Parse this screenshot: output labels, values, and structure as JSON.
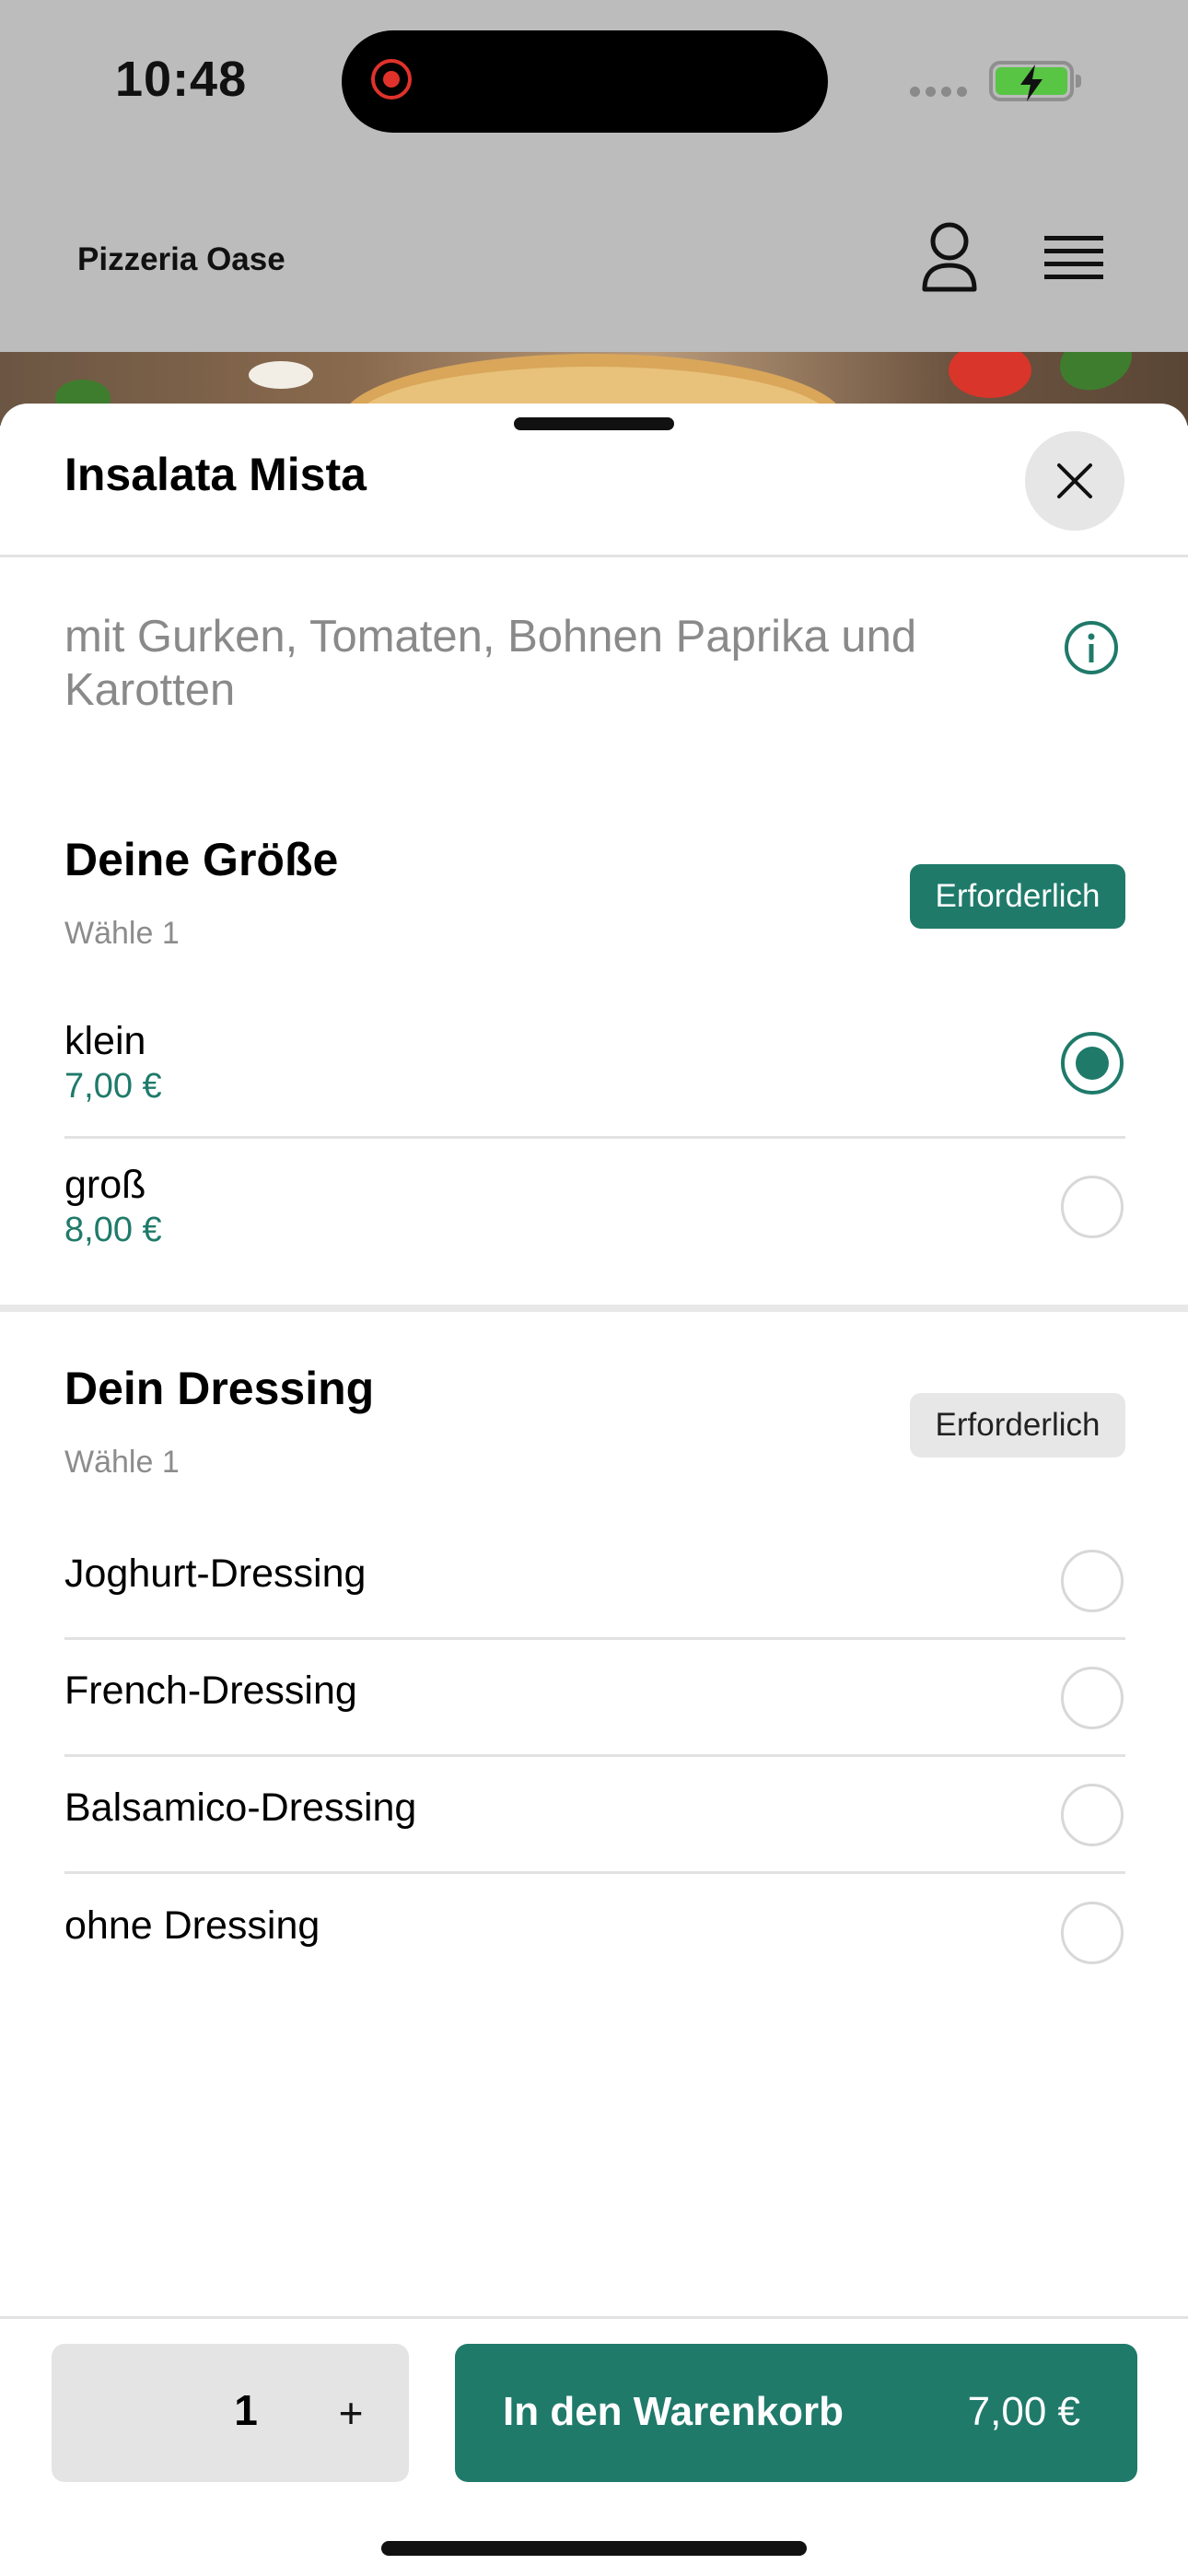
{
  "status_bar": {
    "time": "10:48"
  },
  "app": {
    "title": "Pizzeria Oase"
  },
  "sheet": {
    "title": "Insalata Mista",
    "description": "mit Gurken, Tomaten, Bohnen Paprika und Karotten"
  },
  "size_section": {
    "title": "Deine Größe",
    "subtitle": "Wähle 1",
    "badge": "Erforderlich",
    "options": [
      {
        "label": "klein",
        "price": "7,00 €",
        "selected": true
      },
      {
        "label": "groß",
        "price": "8,00 €",
        "selected": false
      }
    ]
  },
  "dressing_section": {
    "title": "Dein Dressing",
    "subtitle": "Wähle 1",
    "badge": "Erforderlich",
    "options": [
      {
        "label": "Joghurt-Dressing",
        "selected": false
      },
      {
        "label": "French-Dressing",
        "selected": false
      },
      {
        "label": "Balsamico-Dressing",
        "selected": false
      },
      {
        "label": "ohne Dressing",
        "selected": false
      }
    ]
  },
  "footer": {
    "quantity": "1",
    "plus": "+",
    "cart_label": "In den Warenkorb",
    "cart_price": "7,00 €"
  },
  "colors": {
    "accent": "#1f7a6a",
    "header_bg": "#bcbcbc"
  },
  "icons": [
    "user-icon",
    "menu-icon",
    "close-icon",
    "info-icon",
    "battery-icon"
  ]
}
